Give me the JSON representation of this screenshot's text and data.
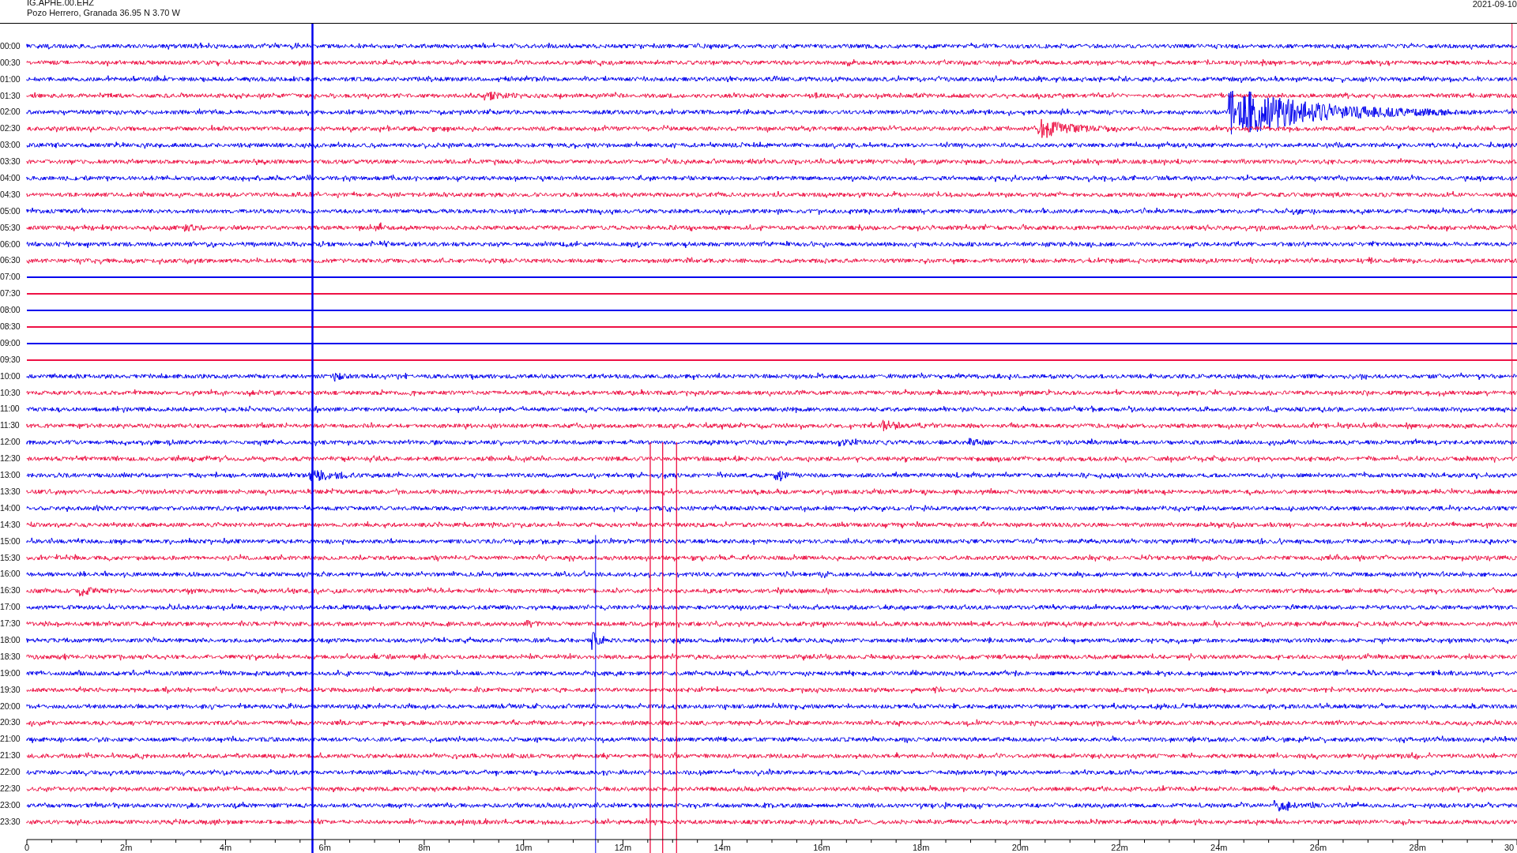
{
  "header": {
    "station_code": "IG.APHE.00.EHZ",
    "location": "Pozo Herrero, Granada  36.95 N 3.70 W",
    "date": "2021-09-10"
  },
  "rows": [
    {
      "label": "00:00",
      "color": "#0000ee",
      "kind": "signal"
    },
    {
      "label": "00:30",
      "color": "#ee1144",
      "kind": "signal"
    },
    {
      "label": "01:00",
      "color": "#0000ee",
      "kind": "signal"
    },
    {
      "label": "01:30",
      "color": "#ee1144",
      "kind": "signal"
    },
    {
      "label": "02:00",
      "color": "#0000ee",
      "kind": "signal"
    },
    {
      "label": "02:30",
      "color": "#ee1144",
      "kind": "signal"
    },
    {
      "label": "03:00",
      "color": "#0000ee",
      "kind": "signal"
    },
    {
      "label": "03:30",
      "color": "#ee1144",
      "kind": "signal"
    },
    {
      "label": "04:00",
      "color": "#0000ee",
      "kind": "signal"
    },
    {
      "label": "04:30",
      "color": "#ee1144",
      "kind": "signal"
    },
    {
      "label": "05:00",
      "color": "#0000ee",
      "kind": "signal"
    },
    {
      "label": "05:30",
      "color": "#ee1144",
      "kind": "signal"
    },
    {
      "label": "06:00",
      "color": "#0000ee",
      "kind": "signal"
    },
    {
      "label": "06:30",
      "color": "#ee1144",
      "kind": "signal"
    },
    {
      "label": "07:00",
      "color": "#0000ee",
      "kind": "flat"
    },
    {
      "label": "07:30",
      "color": "#ee1144",
      "kind": "flat"
    },
    {
      "label": "08:00",
      "color": "#0000ee",
      "kind": "flat"
    },
    {
      "label": "08:30",
      "color": "#ee1144",
      "kind": "flat"
    },
    {
      "label": "09:00",
      "color": "#0000ee",
      "kind": "flat"
    },
    {
      "label": "09:30",
      "color": "#ee1144",
      "kind": "flat"
    },
    {
      "label": "10:00",
      "color": "#0000ee",
      "kind": "signal"
    },
    {
      "label": "10:30",
      "color": "#ee1144",
      "kind": "signal"
    },
    {
      "label": "11:00",
      "color": "#0000ee",
      "kind": "signal"
    },
    {
      "label": "11:30",
      "color": "#ee1144",
      "kind": "signal"
    },
    {
      "label": "12:00",
      "color": "#0000ee",
      "kind": "signal"
    },
    {
      "label": "12:30",
      "color": "#ee1144",
      "kind": "signal"
    },
    {
      "label": "13:00",
      "color": "#0000ee",
      "kind": "signal"
    },
    {
      "label": "13:30",
      "color": "#ee1144",
      "kind": "signal"
    },
    {
      "label": "14:00",
      "color": "#0000ee",
      "kind": "signal"
    },
    {
      "label": "14:30",
      "color": "#ee1144",
      "kind": "signal"
    },
    {
      "label": "15:00",
      "color": "#0000ee",
      "kind": "signal"
    },
    {
      "label": "15:30",
      "color": "#ee1144",
      "kind": "signal"
    },
    {
      "label": "16:00",
      "color": "#0000ee",
      "kind": "signal"
    },
    {
      "label": "16:30",
      "color": "#ee1144",
      "kind": "signal"
    },
    {
      "label": "17:00",
      "color": "#0000ee",
      "kind": "signal"
    },
    {
      "label": "17:30",
      "color": "#ee1144",
      "kind": "signal"
    },
    {
      "label": "18:00",
      "color": "#0000ee",
      "kind": "signal"
    },
    {
      "label": "18:30",
      "color": "#ee1144",
      "kind": "signal"
    },
    {
      "label": "19:00",
      "color": "#0000ee",
      "kind": "signal"
    },
    {
      "label": "19:30",
      "color": "#ee1144",
      "kind": "signal"
    },
    {
      "label": "20:00",
      "color": "#0000ee",
      "kind": "signal"
    },
    {
      "label": "20:30",
      "color": "#ee1144",
      "kind": "signal"
    },
    {
      "label": "21:00",
      "color": "#0000ee",
      "kind": "signal"
    },
    {
      "label": "21:30",
      "color": "#ee1144",
      "kind": "signal"
    },
    {
      "label": "22:00",
      "color": "#0000ee",
      "kind": "signal"
    },
    {
      "label": "22:30",
      "color": "#ee1144",
      "kind": "signal"
    },
    {
      "label": "23:00",
      "color": "#0000ee",
      "kind": "signal"
    },
    {
      "label": "23:30",
      "color": "#ee1144",
      "kind": "signal"
    }
  ],
  "x_axis": {
    "ticks": [
      "0",
      "2m",
      "4m",
      "6m",
      "8m",
      "10m",
      "12m",
      "14m",
      "16m",
      "18m",
      "20m",
      "22m",
      "24m",
      "26m",
      "28m",
      "30"
    ]
  }
}
